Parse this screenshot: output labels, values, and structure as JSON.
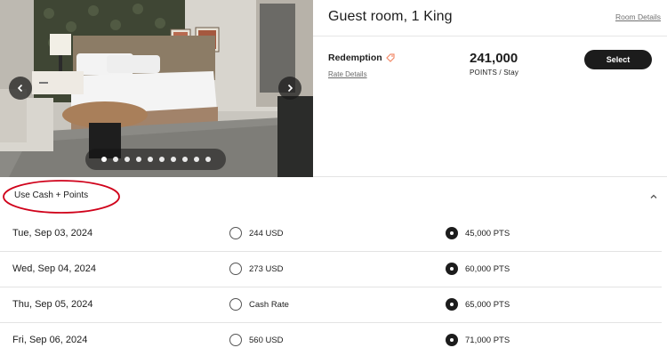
{
  "room": {
    "title": "Guest room, 1 King",
    "details_link": "Room Details",
    "photo_count": 10,
    "active_photo": 1
  },
  "rate": {
    "name": "Redemption",
    "details_link": "Rate Details",
    "points": "241,000",
    "points_unit": "POINTS / Stay",
    "select_label": "Select",
    "tag_icon": "tag-icon"
  },
  "cash_points": {
    "label": "Use Cash + Points",
    "expanded": true,
    "highlight_color": "#d0021b",
    "rows": [
      {
        "date": "Tue, Sep 03, 2024",
        "cash": "244 USD",
        "points": "45,000 PTS",
        "selected": "points"
      },
      {
        "date": "Wed, Sep 04, 2024",
        "cash": "273 USD",
        "points": "60,000 PTS",
        "selected": "points"
      },
      {
        "date": "Thu, Sep 05, 2024",
        "cash": "Cash Rate",
        "points": "65,000 PTS",
        "selected": "points"
      },
      {
        "date": "Fri, Sep 06, 2024",
        "cash": "560 USD",
        "points": "71,000 PTS",
        "selected": "points"
      }
    ]
  },
  "colors": {
    "primary": "#1c1c1c",
    "tag_accent": "#f28b6a",
    "divider": "#e3e3e3"
  }
}
